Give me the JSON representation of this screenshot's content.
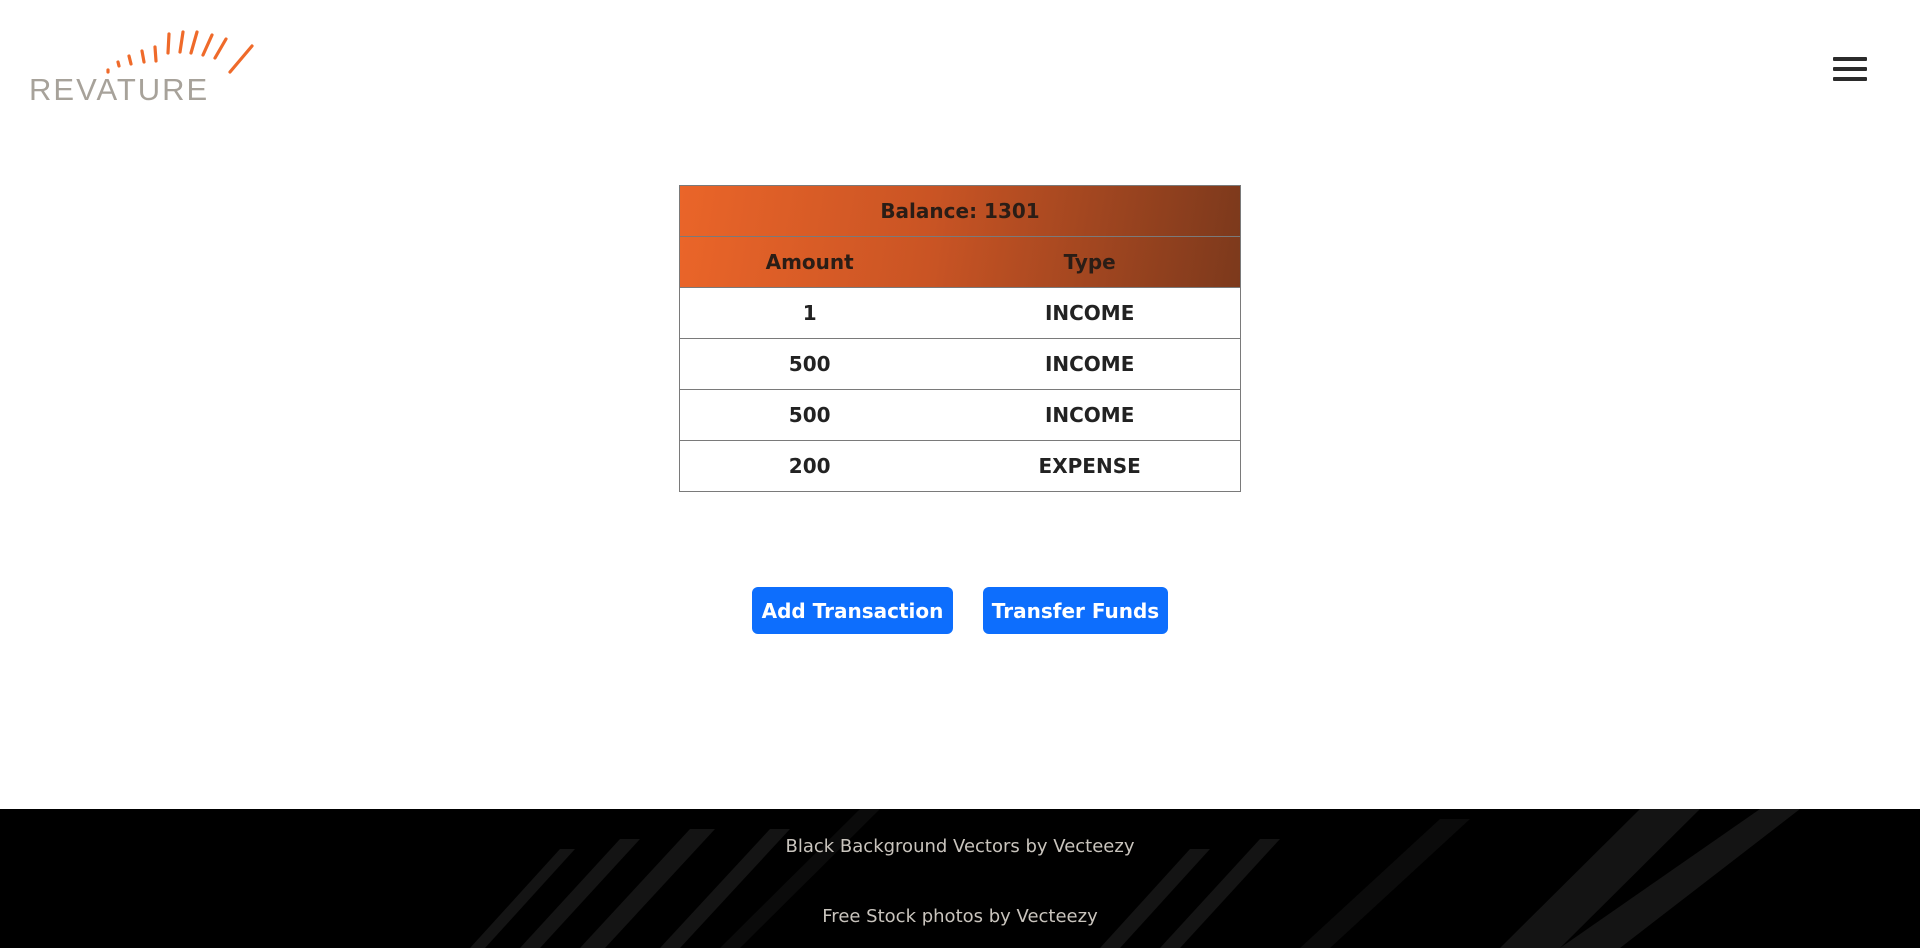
{
  "header": {
    "logo_text": "REVATURE",
    "menu_icon": "hamburger-menu-icon"
  },
  "account": {
    "balance_label": "Balance: 1301",
    "columns": [
      "Amount",
      "Type"
    ],
    "transactions": [
      {
        "amount": "1",
        "type": "INCOME"
      },
      {
        "amount": "500",
        "type": "INCOME"
      },
      {
        "amount": "500",
        "type": "INCOME"
      },
      {
        "amount": "200",
        "type": "EXPENSE"
      }
    ]
  },
  "actions": {
    "add_transaction": "Add Transaction",
    "transfer_funds": "Transfer Funds"
  },
  "footer": {
    "link_1": "Black Background Vectors by Vecteezy",
    "link_2": "Free Stock photos by Vecteezy"
  },
  "colors": {
    "accent_orange": "#ea6529",
    "header_dark": "#7c391c",
    "button_blue": "#0d6efd",
    "footer_bg": "#000000"
  }
}
